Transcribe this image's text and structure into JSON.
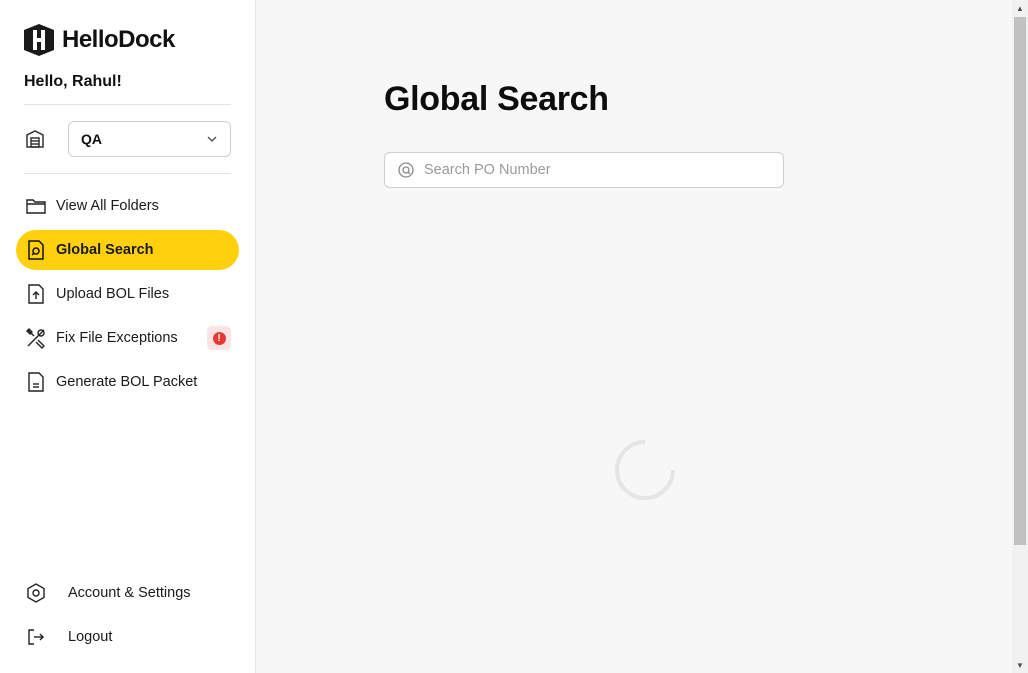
{
  "brand": {
    "name": "HelloDock"
  },
  "greeting": "Hello, Rahul!",
  "warehouse": {
    "selected": "QA"
  },
  "nav": [
    {
      "label": "View All Folders",
      "icon": "folder-icon",
      "active": false
    },
    {
      "label": "Global Search",
      "icon": "file-search-icon",
      "active": true
    },
    {
      "label": "Upload BOL Files",
      "icon": "file-upload-icon",
      "active": false
    },
    {
      "label": "Fix File Exceptions",
      "icon": "tools-icon",
      "active": false,
      "alert": "!"
    },
    {
      "label": "Generate BOL Packet",
      "icon": "document-icon",
      "active": false
    }
  ],
  "bottom_nav": [
    {
      "label": "Account & Settings",
      "icon": "settings-icon"
    },
    {
      "label": "Logout",
      "icon": "logout-icon"
    }
  ],
  "main": {
    "title": "Global Search",
    "search": {
      "placeholder": "Search PO Number",
      "value": ""
    },
    "loading": true
  },
  "colors": {
    "accent": "#ffd00d",
    "alert": "#e53935",
    "alert_bg": "#fde3e3"
  }
}
